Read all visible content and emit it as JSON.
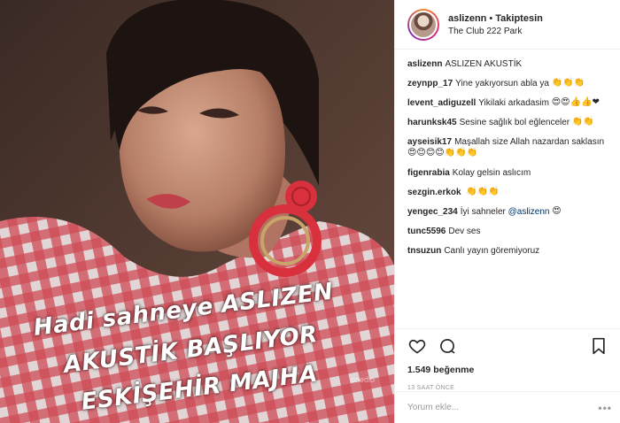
{
  "photo": {
    "alt_overlay_lines": [
      "Hadi sahneye ASLIZEN",
      "AKUSTİK BAŞLIYOR",
      "ESKİŞEHİR MAJHA"
    ],
    "watermark": "onedio"
  },
  "header": {
    "username": "aslizenn",
    "separator": "•",
    "follow_status": "Takiptesin",
    "location": "The Club 222 Park"
  },
  "comments": [
    {
      "user": "aslizenn",
      "text": "ASLIZEN AKUSTİK",
      "emoji": ""
    },
    {
      "user": "zeynpp_17",
      "text": "Yine yakıyorsun abla ya",
      "emoji": "👏👏👏"
    },
    {
      "user": "levent_adiguzell",
      "text": "Yikilaki arkadasim",
      "emoji": "😍😍👍👍❤"
    },
    {
      "user": "harunksk45",
      "text": "Sesine sağlık bol eğlenceler",
      "emoji": "👏👏"
    },
    {
      "user": "ayseisik17",
      "text": "Maşallah size Allah nazardan saklasın",
      "emoji": "😍😊😊😊👏👏👏"
    },
    {
      "user": "figenrabia",
      "text": "Kolay gelsin aslıcım",
      "emoji": ""
    },
    {
      "user": "sezgin.erkok",
      "text": "",
      "emoji": "👏👏👏"
    },
    {
      "user": "yengec_234",
      "text": "İyi sahneler",
      "mention": "@aslizenn",
      "emoji": "😍"
    },
    {
      "user": "tunc5596",
      "text": "Dev ses",
      "emoji": ""
    },
    {
      "user": "tnsuzun",
      "text": "Canlı yayın göremiyoruz",
      "emoji": ""
    }
  ],
  "actions": {
    "likes": "1.549 beğenme",
    "time": "13 SAAT ÖNCE",
    "icons": [
      "heart-icon",
      "comment-icon",
      "bookmark-icon"
    ]
  },
  "add_comment": {
    "placeholder": "Yorum ekle...",
    "more": "•••"
  },
  "colors": {
    "border": "#efefef",
    "text": "#262626",
    "muted": "#999999",
    "mention": "#003569",
    "story_ring": "#dd2a7b"
  }
}
